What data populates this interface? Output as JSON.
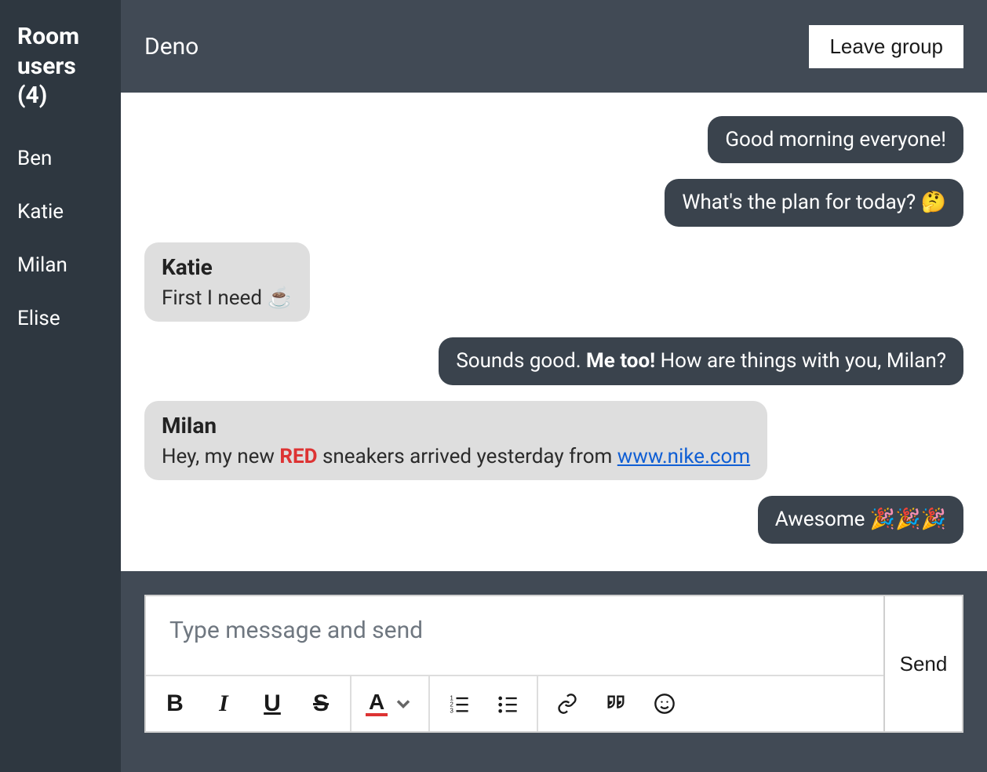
{
  "sidebar": {
    "title": "Room users (4)",
    "users": [
      "Ben",
      "Katie",
      "Milan",
      "Elise"
    ]
  },
  "header": {
    "title": "Deno",
    "leave_label": "Leave group"
  },
  "messages": [
    {
      "side": "right",
      "text": "Good morning everyone!"
    },
    {
      "side": "right",
      "text_html": "What's the plan for today? 🤔"
    },
    {
      "side": "left",
      "sender": "Katie",
      "text_html": "First I need ☕"
    },
    {
      "side": "right",
      "text_html": "Sounds good. <span class=\"strong\">Me too!</span> How are things with you, Milan?"
    },
    {
      "side": "left",
      "sender": "Milan",
      "text_html": "Hey, my new <span class=\"red\">RED</span> sneakers arrived yesterday from <a href=\"#\">www.nike.com</a>"
    },
    {
      "side": "right",
      "text_html": "Awesome 🎉🎉🎉"
    }
  ],
  "composer": {
    "placeholder": "Type message and send",
    "send_label": "Send"
  },
  "toolbar": {
    "color_letter": "A"
  }
}
